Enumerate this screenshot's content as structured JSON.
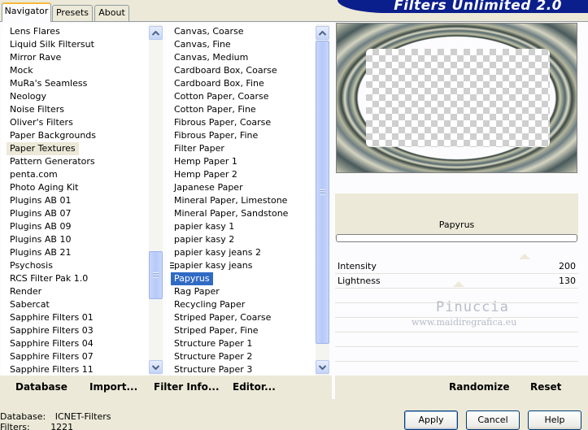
{
  "tabs": [
    {
      "label": "Navigator",
      "active": true
    },
    {
      "label": "Presets",
      "active": false
    },
    {
      "label": "About",
      "active": false
    }
  ],
  "banner": {
    "title": "Filters Unlimited 2.0"
  },
  "categories": {
    "items": [
      "Lens Flares",
      "Liquid Silk Filtersut",
      "Mirror Rave",
      "Mock",
      "MuRa's Seamless",
      "Neology",
      "Noise Filters",
      "Oliver's Filters",
      "Paper Backgrounds",
      "Paper Textures",
      "Pattern Generators",
      "penta.com",
      "Photo Aging Kit",
      "Plugins AB 01",
      "Plugins AB 07",
      "Plugins AB 09",
      "Plugins AB 10",
      "Plugins AB 21",
      "Psychosis",
      "RCS Filter Pak 1.0",
      "Render",
      "Sabercat",
      "Sapphire Filters 01",
      "Sapphire Filters 03",
      "Sapphire Filters 04",
      "Sapphire Filters 07",
      "Sapphire Filters 11"
    ],
    "selected": "Paper Textures"
  },
  "filters": {
    "items": [
      "Canvas, Coarse",
      "Canvas, Fine",
      "Canvas, Medium",
      "Cardboard Box, Coarse",
      "Cardboard Box, Fine",
      "Cotton Paper, Coarse",
      "Cotton Paper, Fine",
      "Fibrous Paper, Coarse",
      "Fibrous Paper, Fine",
      "Filter Paper",
      "Hemp Paper 1",
      "Hemp Paper 2",
      "Japanese Paper",
      "Mineral Paper, Limestone",
      "Mineral Paper, Sandstone",
      "papier kasy 1",
      "papier kasy 2",
      "papier kasy jeans 2",
      "papier kasy jeans",
      "Papyrus",
      "Rag Paper",
      "Recycling Paper",
      "Striped Paper, Coarse",
      "Striped Paper, Fine",
      "Structure Paper 1",
      "Structure Paper 2",
      "Structure Paper 3"
    ],
    "selected": "Papyrus"
  },
  "preview": {
    "filter_name": "Papyrus"
  },
  "params": [
    {
      "label": "Intensity",
      "value": "200",
      "level": 0.78
    },
    {
      "label": "Lightness",
      "value": "130",
      "level": 0.51
    }
  ],
  "watermark": {
    "line1": "Pinuccia",
    "line2": "www.maidiregrafica.eu"
  },
  "toolbar": {
    "database": "Database",
    "import": "Import...",
    "filter_info": "Filter Info...",
    "editor": "Editor...",
    "randomize": "Randomize",
    "reset": "Reset"
  },
  "buttons": {
    "apply": "Apply",
    "cancel": "Cancel",
    "help": "Help"
  },
  "status": {
    "database_label": "Database:",
    "database_value": "ICNET-Filters",
    "filters_label": "Filters:",
    "filters_value": "1221"
  },
  "colors": {
    "selection": "#316ac5",
    "banner": "#0b1f8c",
    "highlight": "#ece9d8"
  }
}
